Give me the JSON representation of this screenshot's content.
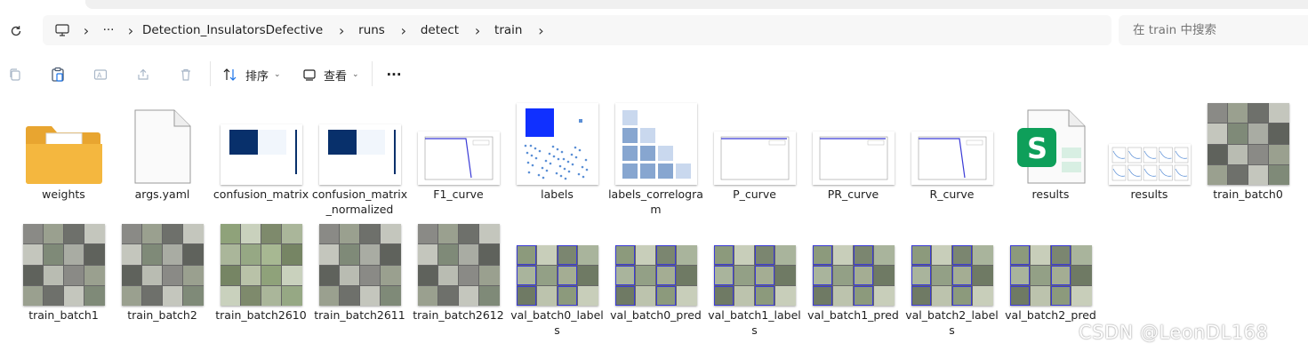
{
  "breadcrumb": {
    "overflow": "···",
    "items": [
      "Detection_InsulatorsDefective",
      "runs",
      "detect",
      "train"
    ]
  },
  "search": {
    "placeholder": "在 train 中搜索"
  },
  "toolbar": {
    "sort_label": "排序",
    "view_label": "查看",
    "more_label": "···"
  },
  "files": [
    {
      "name": "weights",
      "kind": "folder"
    },
    {
      "name": "args.yaml",
      "kind": "doc"
    },
    {
      "name": "confusion_matrix",
      "kind": "confusion"
    },
    {
      "name": "confusion_matrix_normalized",
      "kind": "confusion"
    },
    {
      "name": "F1_curve",
      "kind": "curve"
    },
    {
      "name": "labels",
      "kind": "labels"
    },
    {
      "name": "labels_correlogram",
      "kind": "correlogram"
    },
    {
      "name": "P_curve",
      "kind": "curve-flat"
    },
    {
      "name": "PR_curve",
      "kind": "curve-flat"
    },
    {
      "name": "R_curve",
      "kind": "curve"
    },
    {
      "name": "results",
      "kind": "sheet"
    },
    {
      "name": "results",
      "kind": "resultsplot"
    },
    {
      "name": "train_batch0",
      "kind": "batch-gray"
    },
    {
      "name": "train_batch1",
      "kind": "batch-gray"
    },
    {
      "name": "train_batch2",
      "kind": "batch-gray"
    },
    {
      "name": "train_batch2610",
      "kind": "batch-green"
    },
    {
      "name": "train_batch2611",
      "kind": "batch-gray"
    },
    {
      "name": "train_batch2612",
      "kind": "batch-gray"
    },
    {
      "name": "val_batch0_labels",
      "kind": "batch-val"
    },
    {
      "name": "val_batch0_pred",
      "kind": "batch-val"
    },
    {
      "name": "val_batch1_labels",
      "kind": "batch-val"
    },
    {
      "name": "val_batch1_pred",
      "kind": "batch-val"
    },
    {
      "name": "val_batch2_labels",
      "kind": "batch-val"
    },
    {
      "name": "val_batch2_pred",
      "kind": "batch-val"
    }
  ],
  "watermark": "CSDN @LeonDL168",
  "colors": {
    "folder": "#f4b73f",
    "confusion": "#08306b",
    "curve": "#3b3bd6",
    "sheet": "#0e9f5a",
    "labels": "#1030ff"
  }
}
